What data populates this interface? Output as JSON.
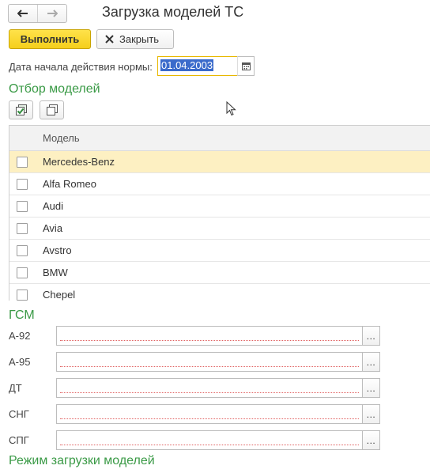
{
  "window": {
    "title": "Загрузка моделей ТС"
  },
  "toolbar": {
    "execute_label": "Выполнить",
    "close_label": "Закрыть"
  },
  "date": {
    "label": "Дата начала действия нормы:",
    "value": "01.04.2003"
  },
  "models": {
    "section_title": "Отбор моделей",
    "column_header": "Модель",
    "rows": [
      {
        "name": "Mercedes-Benz",
        "checked": false,
        "selected": true
      },
      {
        "name": "Alfa Romeo",
        "checked": false,
        "selected": false
      },
      {
        "name": "Audi",
        "checked": false,
        "selected": false
      },
      {
        "name": "Avia",
        "checked": false,
        "selected": false
      },
      {
        "name": "Avstro",
        "checked": false,
        "selected": false
      },
      {
        "name": "BMW",
        "checked": false,
        "selected": false
      },
      {
        "name": "Chepel",
        "checked": false,
        "selected": false
      }
    ]
  },
  "fuel": {
    "section_title": "ГСМ",
    "fields": [
      {
        "label": "А-92",
        "value": "",
        "button": "..."
      },
      {
        "label": "А-95",
        "value": "",
        "button": "..."
      },
      {
        "label": "ДТ",
        "value": "",
        "button": "..."
      },
      {
        "label": "СНГ",
        "value": "",
        "button": "..."
      },
      {
        "label": "СПГ",
        "value": "",
        "button": "..."
      }
    ]
  },
  "load_mode": {
    "section_title": "Режим загрузки моделей"
  },
  "colors": {
    "accent_green": "#3a9a46",
    "primary_button": "#f5cf1c",
    "selected_row": "#fdf0c2",
    "selection_highlight": "#3b6bcb"
  }
}
